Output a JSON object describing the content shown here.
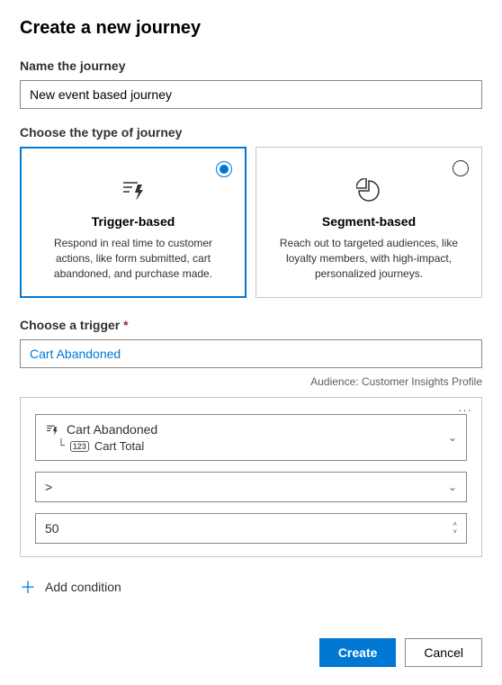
{
  "title": "Create a new journey",
  "name_section": {
    "label": "Name the journey",
    "value": "New event based journey"
  },
  "type_section": {
    "label": "Choose the type of journey",
    "cards": [
      {
        "title": "Trigger-based",
        "desc": "Respond in real time to customer actions, like form submitted, cart abandoned, and purchase made.",
        "selected": true
      },
      {
        "title": "Segment-based",
        "desc": "Reach out to targeted audiences, like loyalty members, with high-impact, personalized journeys.",
        "selected": false
      }
    ]
  },
  "trigger_section": {
    "label": "Choose a trigger",
    "required_mark": "*",
    "value": "Cart Abandoned",
    "audience_prefix": "Audience:",
    "audience_value": "Customer Insights Profile"
  },
  "condition": {
    "attribute_event": "Cart Abandoned",
    "attribute_field": "Cart Total",
    "attribute_badge": "123",
    "operator": ">",
    "value": "50"
  },
  "add_condition_label": "Add condition",
  "footer": {
    "create": "Create",
    "cancel": "Cancel"
  }
}
